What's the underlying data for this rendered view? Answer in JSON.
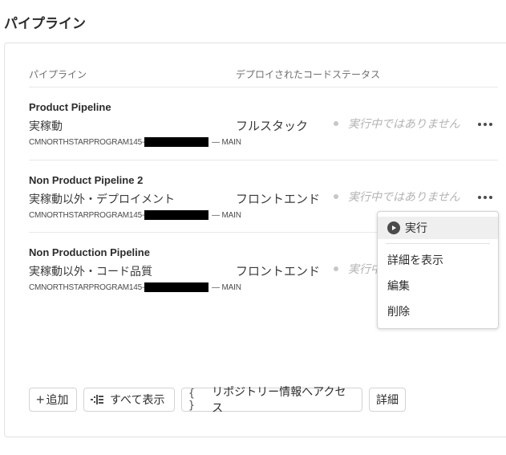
{
  "page": {
    "title": "パイプライン"
  },
  "table": {
    "headers": {
      "pipeline": "パイプライン",
      "deployed_code_status": "デプロイされたコードステータス"
    },
    "rows": [
      {
        "name": "Product Pipeline",
        "environment": "実稼動",
        "repo_prefix": "CMNORTHSTARPROGRAM145-",
        "repo_suffix": "— MAIN",
        "type": "フルスタック",
        "status": "実行中ではありません"
      },
      {
        "name": "Non Product Pipeline 2",
        "environment": "実稼動以外・デプロイメント",
        "repo_prefix": "CMNORTHSTARPROGRAM145-",
        "repo_suffix": "— MAIN",
        "type": "フロントエンド",
        "status": "実行中ではありません"
      },
      {
        "name": "Non Production Pipeline",
        "environment": "実稼動以外・コード品質",
        "repo_prefix": "CMNORTHSTARPROGRAM145-",
        "repo_suffix": "— MAIN",
        "type": "フロントエンド",
        "status": "実行中"
      }
    ]
  },
  "menu": {
    "items": [
      "実行",
      "詳細を表示",
      "編集",
      "削除"
    ]
  },
  "footer": {
    "add": "追加",
    "show_all": "すべて表示",
    "repo_info": "リポジトリー情報へアクセス",
    "details": "詳細"
  },
  "colors": {
    "text": "#2c2c2c",
    "muted": "#b3b3b3",
    "border": "#d3d3d3",
    "redaction": "#000000"
  }
}
